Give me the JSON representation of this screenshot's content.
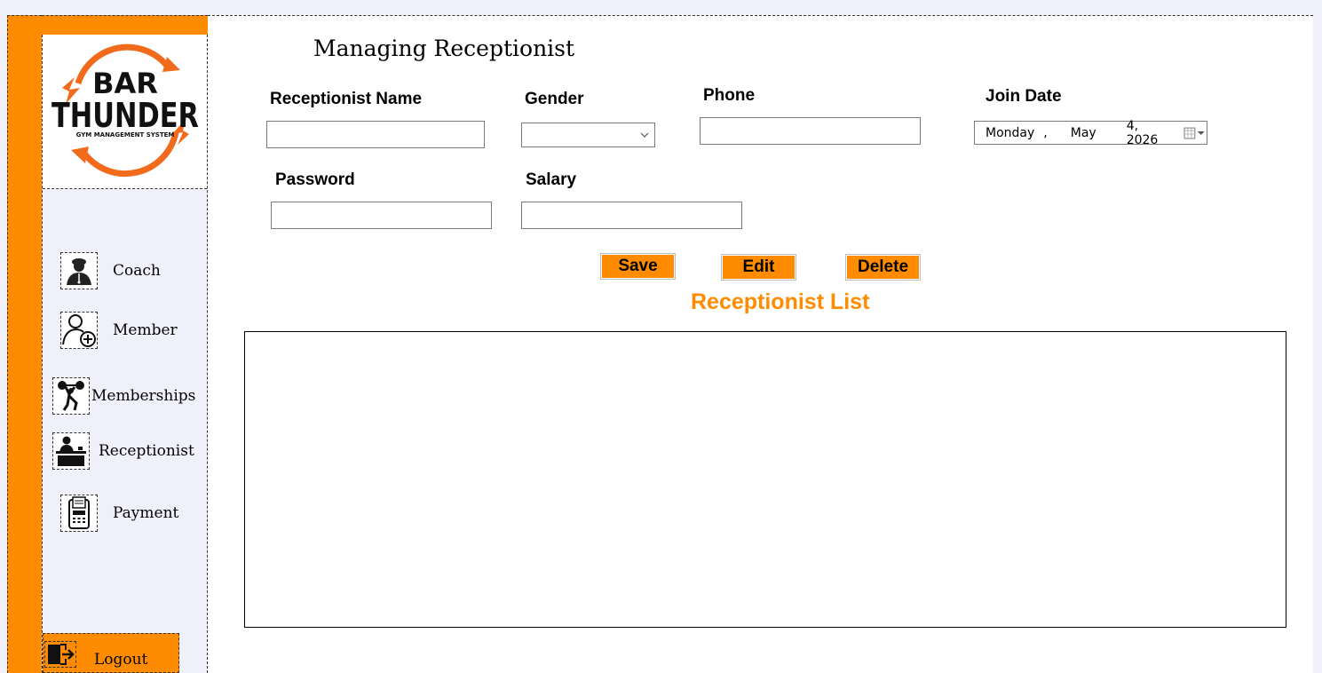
{
  "sidebar": {
    "logo": {
      "line1": "BAR",
      "line2": "THUNDER",
      "tagline": "GYM MANAGEMENT SYSTEM",
      "accent": "#f26b1d"
    },
    "items": [
      {
        "label": "Coach",
        "icon": "coach-icon"
      },
      {
        "label": "Member",
        "icon": "add-member-icon"
      },
      {
        "label": "Memberships",
        "icon": "weightlifter-icon"
      },
      {
        "label": "Receptionist",
        "icon": "receptionist-desk-icon"
      },
      {
        "label": "Payment",
        "icon": "payment-terminal-icon"
      }
    ],
    "logout": {
      "label": "Logout",
      "icon": "logout-door-icon"
    }
  },
  "main": {
    "title": "Managing Receptionist",
    "form": {
      "name_label": "Receptionist Name",
      "name_value": "",
      "gender_label": "Gender",
      "gender_value": "",
      "phone_label": "Phone",
      "phone_value": "",
      "join_date_label": "Join Date",
      "join_date": {
        "weekday": "Monday",
        "sep": ",",
        "month": "May",
        "day_year": "4, 2026"
      },
      "password_label": "Password",
      "password_value": "",
      "salary_label": "Salary",
      "salary_value": ""
    },
    "buttons": {
      "save": "Save",
      "edit": "Edit",
      "delete": "Delete"
    },
    "list_title": "Receptionist List"
  },
  "colors": {
    "accent": "#ff8c00",
    "background": "#eff0f9"
  }
}
